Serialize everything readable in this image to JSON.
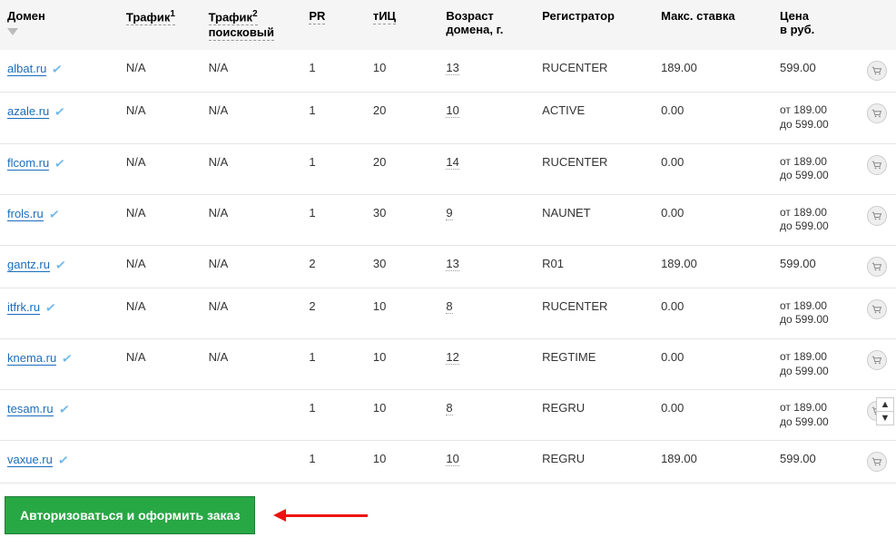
{
  "headers": {
    "domain": "Домен",
    "traffic": "Трафик",
    "traffic_sup": "1",
    "traffic2": "Трафик",
    "traffic2_sup": "2",
    "traffic2_sub": "поисковый",
    "pr": "PR",
    "tic": "тИЦ",
    "age_l1": "Возраст",
    "age_l2": "домена, г.",
    "registrar": "Регистратор",
    "maxbid": "Макс. ставка",
    "price_l1": "Цена",
    "price_l2": "в руб."
  },
  "price_range": {
    "from_label": "от",
    "to_label": "до",
    "from": "189.00",
    "to": "599.00"
  },
  "rows": [
    {
      "domain": "albat.ru",
      "traffic": "N/A",
      "traffic2": "N/A",
      "pr": "1",
      "tic": "10",
      "age": "13",
      "registrar": "RUCENTER",
      "bid": "189.00",
      "price_single": "599.00"
    },
    {
      "domain": "azale.ru",
      "traffic": "N/A",
      "traffic2": "N/A",
      "pr": "1",
      "tic": "20",
      "age": "10",
      "registrar": "ACTIVE",
      "bid": "0.00",
      "price_range": true
    },
    {
      "domain": "flcom.ru",
      "traffic": "N/A",
      "traffic2": "N/A",
      "pr": "1",
      "tic": "20",
      "age": "14",
      "registrar": "RUCENTER",
      "bid": "0.00",
      "price_range": true
    },
    {
      "domain": "frols.ru",
      "traffic": "N/A",
      "traffic2": "N/A",
      "pr": "1",
      "tic": "30",
      "age": "9",
      "registrar": "NAUNET",
      "bid": "0.00",
      "price_range": true
    },
    {
      "domain": "gantz.ru",
      "traffic": "N/A",
      "traffic2": "N/A",
      "pr": "2",
      "tic": "30",
      "age": "13",
      "registrar": "R01",
      "bid": "189.00",
      "price_single": "599.00"
    },
    {
      "domain": "itfrk.ru",
      "traffic": "N/A",
      "traffic2": "N/A",
      "pr": "2",
      "tic": "10",
      "age": "8",
      "registrar": "RUCENTER",
      "bid": "0.00",
      "price_range": true
    },
    {
      "domain": "knema.ru",
      "traffic": "N/A",
      "traffic2": "N/A",
      "pr": "1",
      "tic": "10",
      "age": "12",
      "registrar": "REGTIME",
      "bid": "0.00",
      "price_range": true
    },
    {
      "domain": "tesam.ru",
      "traffic": "",
      "traffic2": "",
      "pr": "1",
      "tic": "10",
      "age": "8",
      "registrar": "REGRU",
      "bid": "0.00",
      "price_range": true
    },
    {
      "domain": "vaxue.ru",
      "traffic": "",
      "traffic2": "",
      "pr": "1",
      "tic": "10",
      "age": "10",
      "registrar": "REGRU",
      "bid": "189.00",
      "price_single": "599.00"
    }
  ],
  "auth_button": "Авторизоваться и оформить заказ",
  "pager": {
    "up": "▲",
    "down": "▼"
  }
}
